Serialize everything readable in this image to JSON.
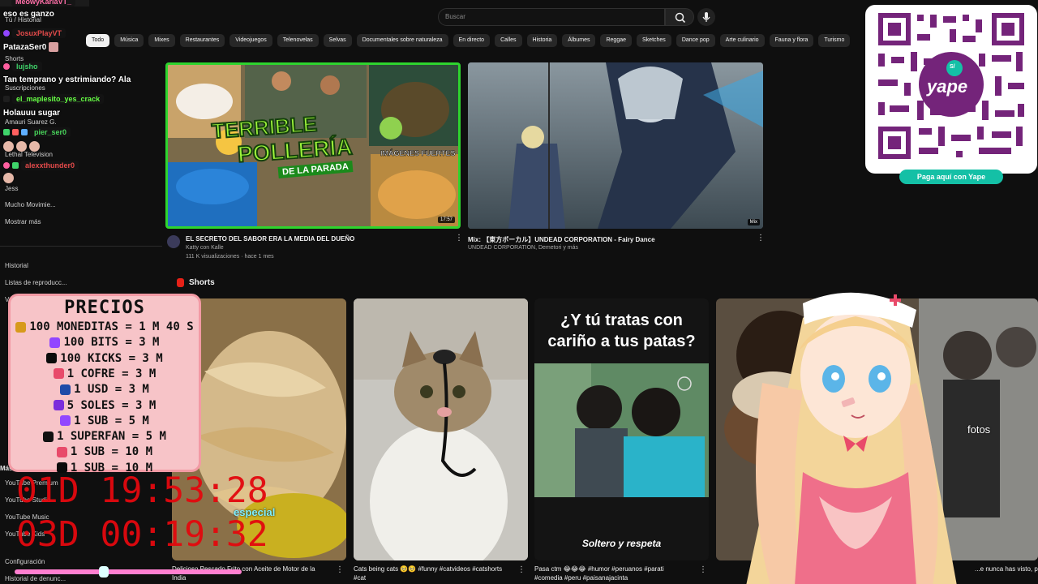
{
  "sidebar": {
    "items_top": [
      "Tú / Historial",
      "Shorts",
      "Suscripciones"
    ],
    "subs": [
      "Amauri Suarez G.",
      "Lethal Television",
      "Jess",
      "Mucho Movimie...",
      "Mostrar más"
    ],
    "you": [
      "Historial",
      "Listas de reproducc...",
      "Ver más"
    ],
    "more_title": "Más de YouTube",
    "more": [
      "YouTube Premium",
      "YouTube Studio",
      "YouTube Music",
      "YouTube Kids"
    ],
    "bottom": [
      "Configuración",
      "Historial de denunc..."
    ]
  },
  "search": {
    "placeholder": "Buscar"
  },
  "chips": [
    "Todo",
    "Música",
    "Mixes",
    "Restaurantes",
    "Videojuegos",
    "Telenovelas",
    "Selvas",
    "Documentales sobre naturaleza",
    "En directo",
    "Calles",
    "Historia",
    "Álbumes",
    "Reggae",
    "Sketches",
    "Dance pop",
    "Arte culinario",
    "Fauna y flora",
    "Turismo"
  ],
  "videos": [
    {
      "title": "EL SECRETO DEL SABOR ERA LA MEDIA DEL DUEÑO",
      "channel": "Katty con Kalle",
      "meta": "111 K visualizaciones · hace 1 mes",
      "duration": "17:57",
      "thumb_text_1": "TERRIBLE",
      "thumb_text_2": "POLLERÍA",
      "thumb_text_3": "DE LA PARADA",
      "thumb_text_4": "IMÁGENES FUERTES"
    },
    {
      "title": "Mix: 【東方ボーカル】UNDEAD CORPORATION - Fairy Dance",
      "channel": "UNDEAD CORPORATION, Demetori y más",
      "duration": "Mix"
    }
  ],
  "shorts": {
    "heading": "Shorts",
    "items": [
      {
        "caption": "Delicioso Pescado Frito con Aceite de Motor de la",
        "caption2": "India",
        "overlay": "especial"
      },
      {
        "caption": "Cats being cats 🥺🥺 #funny #catvideos #catshorts",
        "caption2": "#cat"
      },
      {
        "caption": "Pasa ctm 😂😂😂 #humor #peruanos #parati",
        "caption2": "#comedia #peru #paisanajacinta",
        "overlay_title": "¿Y tú tratas con cariño a tus patas?",
        "brand": "Soltero y respeta"
      },
      {
        "caption": "Le...",
        "overlay": "fotos"
      },
      {
        "caption": "...e nunca has visto, par"
      }
    ]
  },
  "chat": [
    {
      "name": "MeowyKarlaVT_",
      "msg": "",
      "color": "#ff6fa8"
    },
    {
      "name": "",
      "msg": "eso es ganzo",
      "color": "#ffffff"
    },
    {
      "name": "JosuxPlayVT",
      "msg": "",
      "color": "#e34a4a"
    },
    {
      "name": "",
      "msg": "PatazaSer0",
      "color": "#ffffff"
    },
    {
      "name": "lujsho",
      "msg": "",
      "color": "#3fd46a"
    },
    {
      "name": "",
      "msg": "Tan temprano y estrimiando? Ala",
      "color": "#ffffff"
    },
    {
      "name": "el_maplesito_yes_crack",
      "msg": "",
      "color": "#66ff44"
    },
    {
      "name": "",
      "msg": "Holauuu sugar",
      "color": "#ffffff"
    },
    {
      "name": "pier_ser0",
      "msg": "",
      "color": "#48d35a"
    },
    {
      "name": "alexxthunder0",
      "msg": "",
      "color": "#e34a4a"
    }
  ],
  "prices": {
    "title": "PRECIOS",
    "lines": [
      {
        "text": "100 MONEDITAS = 1 M 40 S",
        "icon_color": "#d79a1c"
      },
      {
        "text": "100 BITS = 3 M",
        "icon_color": "#9146ff"
      },
      {
        "text": "100 KICKS = 3 M",
        "icon_color": "#0b0b0b"
      },
      {
        "text": "1 COFRE = 3 M",
        "icon_color": "#e84a6a"
      },
      {
        "text": "1 USD = 3 M",
        "icon_color": "#1f4aa8"
      },
      {
        "text": "5 SOLES = 3 M",
        "icon_color": "#7b2ddb"
      },
      {
        "text": "1 SUB = 5 M",
        "icon_color": "#9146ff"
      },
      {
        "text": "1 SUPERFAN = 5 M",
        "icon_color": "#111111"
      },
      {
        "text": "1 SUB = 10 M",
        "icon_color": "#e84a6a"
      },
      {
        "text": "1 SUB = 10 M",
        "icon_color": "#0b0b0b"
      }
    ]
  },
  "timers": [
    "01D 19:53:28",
    "03D 00:19:32"
  ],
  "yape": {
    "button": "Paga aquí con Yape",
    "logo": "yape",
    "badge": "S/"
  },
  "colors": {
    "accent_red": "#e3080e",
    "yape_teal": "#14c0a6",
    "yape_purple": "#74247a"
  }
}
